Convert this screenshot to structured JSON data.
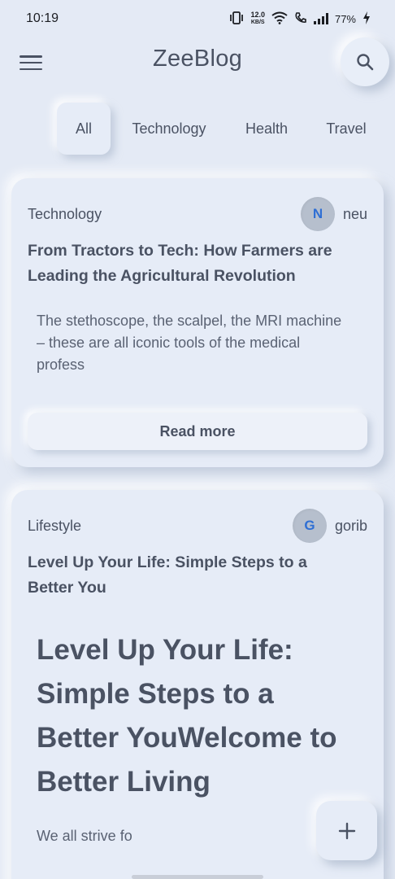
{
  "status_bar": {
    "time": "10:19",
    "net_speed_value": "12.0",
    "net_speed_unit": "KB/S",
    "battery": "77%"
  },
  "app_bar": {
    "title": "ZeeBlog"
  },
  "tabs": [
    {
      "label": "All",
      "active": true
    },
    {
      "label": "Technology",
      "active": false
    },
    {
      "label": "Health",
      "active": false
    },
    {
      "label": "Travel",
      "active": false
    }
  ],
  "posts": [
    {
      "category": "Technology",
      "author_initial": "N",
      "author": "neu",
      "title": "From Tractors to Tech: How Farmers are Leading the Agricultural Revolution",
      "excerpt": "The stethoscope, the scalpel, the MRI machine – these are all iconic tools of the medical profess",
      "button": "Read more"
    },
    {
      "category": "Lifestyle",
      "author_initial": "G",
      "author": "gorib",
      "title": "Level Up Your Life: Simple Steps to a Better You",
      "heading": "Level Up Your Life: Simple Steps to a Better YouWelcome to Better Living",
      "excerpt": "We all strive fo"
    }
  ],
  "colors": {
    "background": "#e4eaf5",
    "text": "#4a5263",
    "avatar_initial": "#2f6fd4"
  }
}
